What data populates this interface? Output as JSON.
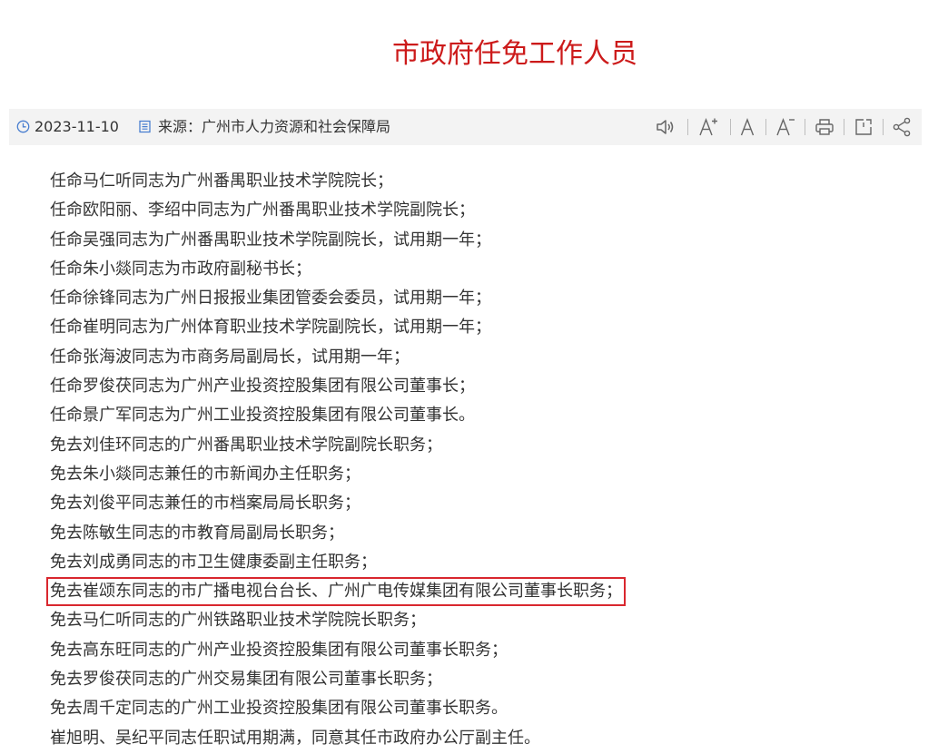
{
  "page": {
    "title": "市政府任免工作人员"
  },
  "meta": {
    "date": "2023-11-10",
    "source": "来源：广州市人力资源和社会保障局",
    "date_icon": "clock-icon",
    "source_icon": "document-icon"
  },
  "toolbar": {
    "icons": [
      "speaker-icon",
      "font-increase-icon",
      "font-default-icon",
      "font-decrease-icon",
      "print-icon",
      "export-icon",
      "share-icon"
    ]
  },
  "colors": {
    "title": "#cc1a1a",
    "meta_icon": "#4a7fd0",
    "toolbar_bg": "#f3f3f3",
    "tool_icon": "#666666",
    "highlight_border": "#d9272e",
    "body_text": "#333333"
  },
  "content": {
    "lines": [
      {
        "text": "任命马仁听同志为广州番禺职业技术学院院长；"
      },
      {
        "text": "任命欧阳丽、李绍中同志为广州番禺职业技术学院副院长；"
      },
      {
        "text": "任命吴强同志为广州番禺职业技术学院副院长，试用期一年；"
      },
      {
        "text": "任命朱小燚同志为市政府副秘书长；"
      },
      {
        "text": "任命徐锋同志为广州日报报业集团管委会委员，试用期一年；"
      },
      {
        "text": "任命崔明同志为广州体育职业技术学院副院长，试用期一年；"
      },
      {
        "text": "任命张海波同志为市商务局副局长，试用期一年；"
      },
      {
        "text": "任命罗俊茯同志为广州产业投资控股集团有限公司董事长；"
      },
      {
        "text": "任命景广军同志为广州工业投资控股集团有限公司董事长。"
      },
      {
        "text": "免去刘佳环同志的广州番禺职业技术学院副院长职务；"
      },
      {
        "text": "免去朱小燚同志兼任的市新闻办主任职务；"
      },
      {
        "text": "免去刘俊平同志兼任的市档案局局长职务；"
      },
      {
        "text": "免去陈敏生同志的市教育局副局长职务；"
      },
      {
        "text": "免去刘成勇同志的市卫生健康委副主任职务；"
      },
      {
        "text": "免去崔颂东同志的市广播电视台台长、广州广电传媒集团有限公司董事长职务；",
        "highlighted": true
      },
      {
        "text": "免去马仁听同志的广州铁路职业技术学院院长职务；"
      },
      {
        "text": "免去高东旺同志的广州产业投资控股集团有限公司董事长职务；"
      },
      {
        "text": "免去罗俊茯同志的广州交易集团有限公司董事长职务；"
      },
      {
        "text": "免去周千定同志的广州工业投资控股集团有限公司董事长职务。"
      },
      {
        "text": "崔旭明、吴纪平同志任职试用期满，同意其任市政府办公厅副主任。"
      }
    ]
  }
}
